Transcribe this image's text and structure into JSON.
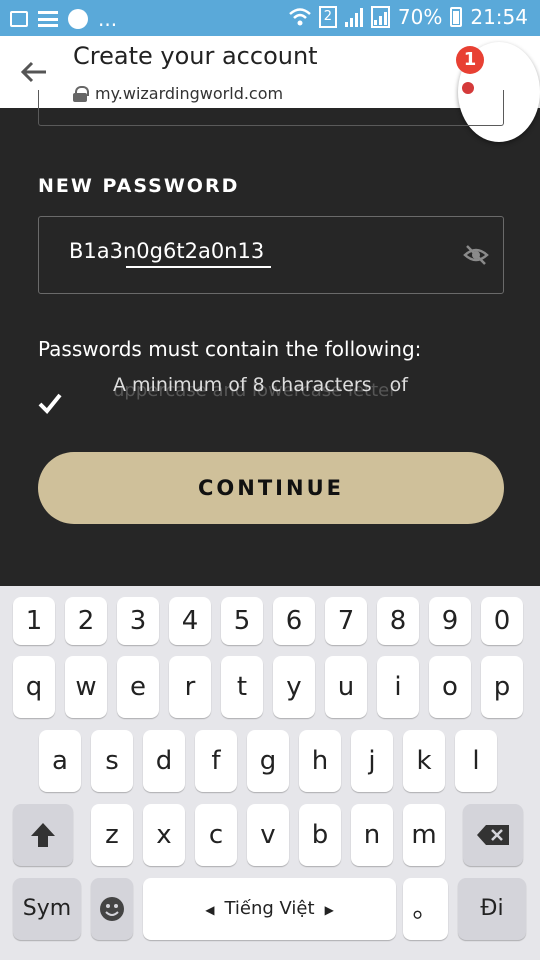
{
  "status_bar": {
    "network": "2",
    "battery": "70%",
    "time": "21:54",
    "icons": [
      "gallery-icon",
      "list-icon",
      "messenger-icon",
      "more-icon",
      "wifi-icon",
      "signal-icon",
      "battery-icon"
    ],
    "more": "..."
  },
  "browser": {
    "title": "Create your account",
    "url": "my.wizardingworld.com",
    "notification_count": "1"
  },
  "form": {
    "password_label": "NEW PASSWORD",
    "password_value": "B1a3n0g6t2a0n13",
    "rules_heading": "Passwords must contain the following:",
    "rule_text": "A minimum of 8 characters",
    "rule_ghost": "uppercase and lowercase letter",
    "rule_tail": "of",
    "continue_label": "CONTINUE"
  },
  "keyboard": {
    "row1": [
      "1",
      "2",
      "3",
      "4",
      "5",
      "6",
      "7",
      "8",
      "9",
      "0"
    ],
    "row2": [
      "q",
      "w",
      "e",
      "r",
      "t",
      "y",
      "u",
      "i",
      "o",
      "p"
    ],
    "row3": [
      "a",
      "s",
      "d",
      "f",
      "g",
      "h",
      "j",
      "k",
      "l"
    ],
    "row4": [
      "z",
      "x",
      "c",
      "v",
      "b",
      "n",
      "m"
    ],
    "sym_label": "Sym",
    "space_label": "Tiếng Việt",
    "period": "。",
    "enter_label": "Đi"
  }
}
